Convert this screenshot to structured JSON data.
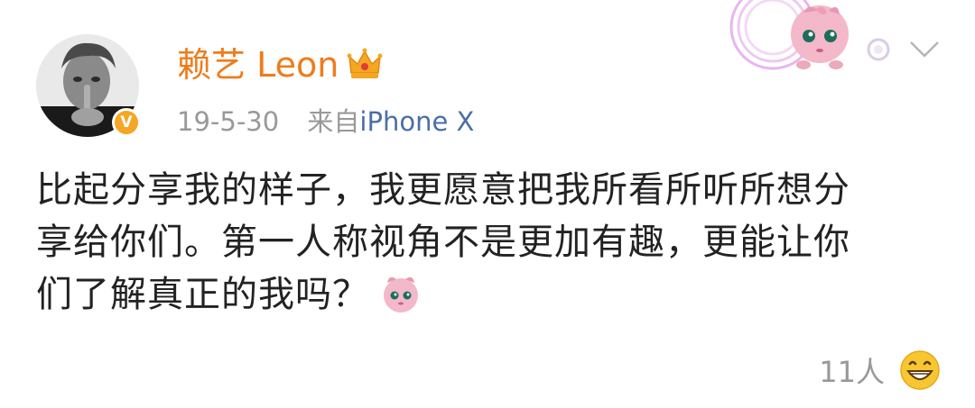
{
  "post": {
    "username": "赖艺 Leon",
    "date": "19-5-30",
    "source_prefix": "来自",
    "device": "iPhone X",
    "content_lines": [
      "比起分享我的样子，我更愿意把我所看所听所想分",
      "享给你们。第一人称视角不是更加有趣，更能让你",
      "们了解真正的我吗？"
    ],
    "reaction_count": "11人",
    "verified_badge": "V"
  },
  "icons": {
    "avatar": "avatar-portrait",
    "crown": "crown-icon",
    "sticker": "jigglypuff-sticker",
    "chevron": "chevron-down-icon",
    "emoji": "jigglypuff-emoji",
    "reaction": "grinning-face-icon"
  },
  "colors": {
    "username": "#f07b1a",
    "device_link": "#4a6fa5",
    "meta": "#999999",
    "badge": "#f5a623",
    "text": "#222222"
  }
}
